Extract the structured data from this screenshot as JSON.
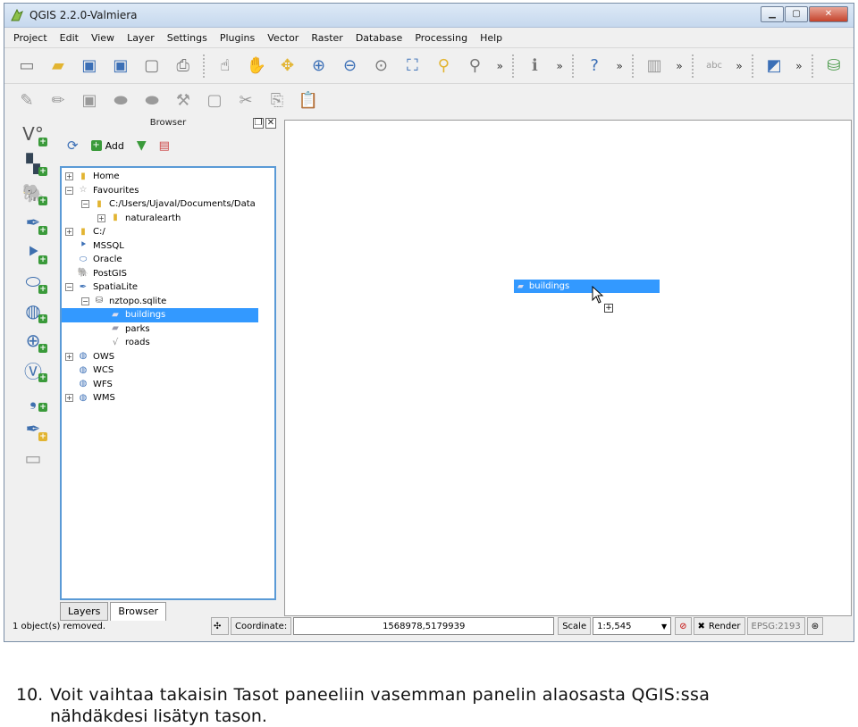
{
  "window": {
    "title": "QGIS 2.2.0-Valmiera",
    "buttons": [
      "minimize",
      "maximize",
      "close"
    ]
  },
  "menu": [
    "Project",
    "Edit",
    "View",
    "Layer",
    "Settings",
    "Plugins",
    "Vector",
    "Raster",
    "Database",
    "Processing",
    "Help"
  ],
  "browser": {
    "title": "Browser",
    "tools": {
      "refresh": "refresh-icon",
      "add_label": "Add",
      "filter": "filter-icon",
      "collapse": "collapse-icon"
    },
    "tree": [
      {
        "label": "Home",
        "indent": 0,
        "expander": "+",
        "icon": "folder"
      },
      {
        "label": "Favourites",
        "indent": 0,
        "expander": "-",
        "icon": "star"
      },
      {
        "label": "C:/Users/Ujaval/Documents/Data",
        "indent": 1,
        "expander": "-",
        "icon": "folder"
      },
      {
        "label": "naturalearth",
        "indent": 2,
        "expander": "+",
        "icon": "folder"
      },
      {
        "label": "C:/",
        "indent": 0,
        "expander": "+",
        "icon": "folder"
      },
      {
        "label": "MSSQL",
        "indent": 0,
        "expander": "",
        "icon": "mssql"
      },
      {
        "label": "Oracle",
        "indent": 0,
        "expander": "",
        "icon": "oracle"
      },
      {
        "label": "PostGIS",
        "indent": 0,
        "expander": "",
        "icon": "postgis"
      },
      {
        "label": "SpatiaLite",
        "indent": 0,
        "expander": "-",
        "icon": "spatialite"
      },
      {
        "label": "nztopo.sqlite",
        "indent": 1,
        "expander": "-",
        "icon": "db"
      },
      {
        "label": "buildings",
        "indent": 2,
        "expander": "",
        "icon": "polygon",
        "selected": true
      },
      {
        "label": "parks",
        "indent": 2,
        "expander": "",
        "icon": "polygon"
      },
      {
        "label": "roads",
        "indent": 2,
        "expander": "",
        "icon": "line"
      },
      {
        "label": "OWS",
        "indent": 0,
        "expander": "+",
        "icon": "globe"
      },
      {
        "label": "WCS",
        "indent": 0,
        "expander": "",
        "icon": "globe"
      },
      {
        "label": "WFS",
        "indent": 0,
        "expander": "",
        "icon": "globe"
      },
      {
        "label": "WMS",
        "indent": 0,
        "expander": "+",
        "icon": "globe"
      }
    ]
  },
  "tabs": [
    "Layers",
    "Browser"
  ],
  "canvas": {
    "drag_label": "buildings"
  },
  "status": {
    "message": "1 object(s) removed.",
    "coordinate_label": "Coordinate:",
    "coordinate_value": "1568978,5179939",
    "scale_label": "Scale",
    "scale_value": "1:5,545",
    "render_label": "Render",
    "crs": "EPSG:2193"
  },
  "caption": {
    "number": "10.",
    "line1": "Voit vaihtaa takaisin Tasot paneeliin vasemman panelin alaosasta QGIS:ssa",
    "line2": "nähdäkdesi lisätyn tason."
  },
  "colors": {
    "selection": "#3399ff",
    "tree_border": "#5a9ad6",
    "folder": "#e2b431"
  }
}
